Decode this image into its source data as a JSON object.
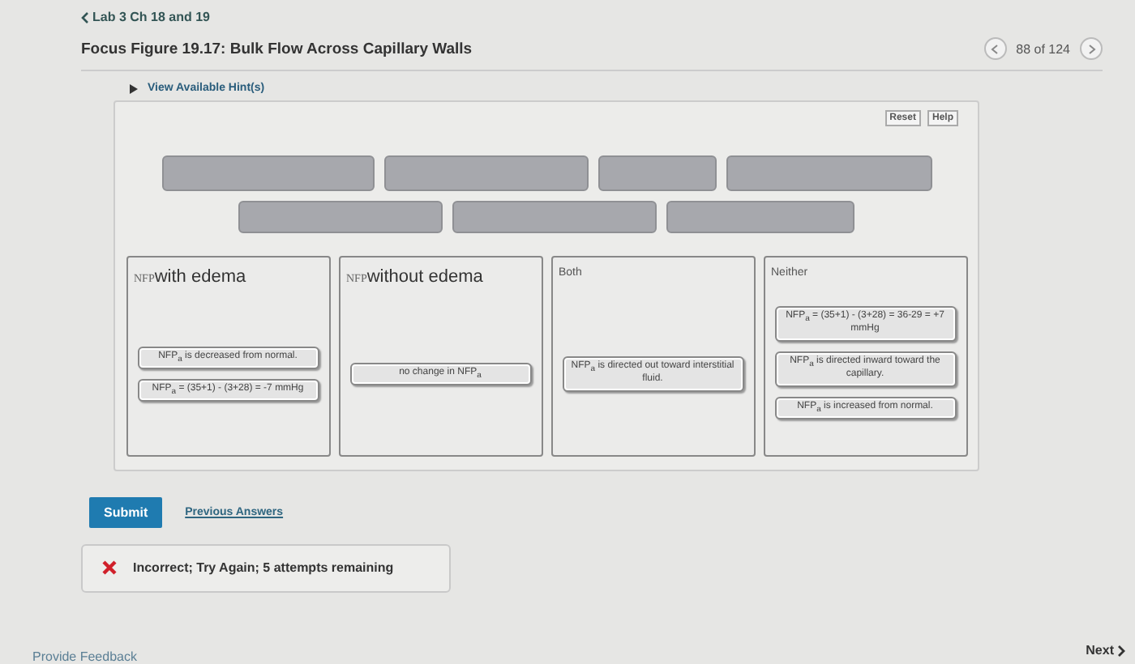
{
  "breadcrumb": "Lab 3 Ch 18 and 19",
  "title": "Focus Figure 19.17: Bulk Flow Across Capillary Walls",
  "pager": {
    "position": "88 of 124"
  },
  "hints": {
    "label": "View Available Hint(s)",
    "expanded": false
  },
  "tools": [
    "Reset",
    "Help"
  ],
  "bins": [
    {
      "prefix": "NFP",
      "label": "with edema",
      "items": [
        "NFP$_{a}$ is decreased from normal.",
        "NFP$_{a}$ = (35+1) - (3+28) = -7 mmHg"
      ]
    },
    {
      "prefix": "NFP",
      "label": "without edema",
      "items": [
        "no change in NFP$_{a}$"
      ]
    },
    {
      "label": "Both",
      "items": [
        "NFP$_{a}$ is directed out toward interstitial fluid."
      ]
    },
    {
      "label": "Neither",
      "items": [
        "NFP$_{a}$ = (35+1) - (3+28) = 36-29 = +7 mmHg",
        "NFP$_{a}$ is directed inward toward the capillary.",
        "NFP$_{a}$ is increased from normal."
      ]
    }
  ],
  "submit": "Submit",
  "previous_answers": "Previous Answers",
  "feedback": {
    "correct": false,
    "message": "Incorrect; Try Again; 5 attempts remaining"
  },
  "provide_feedback": "Provide Feedback",
  "next": "Next"
}
